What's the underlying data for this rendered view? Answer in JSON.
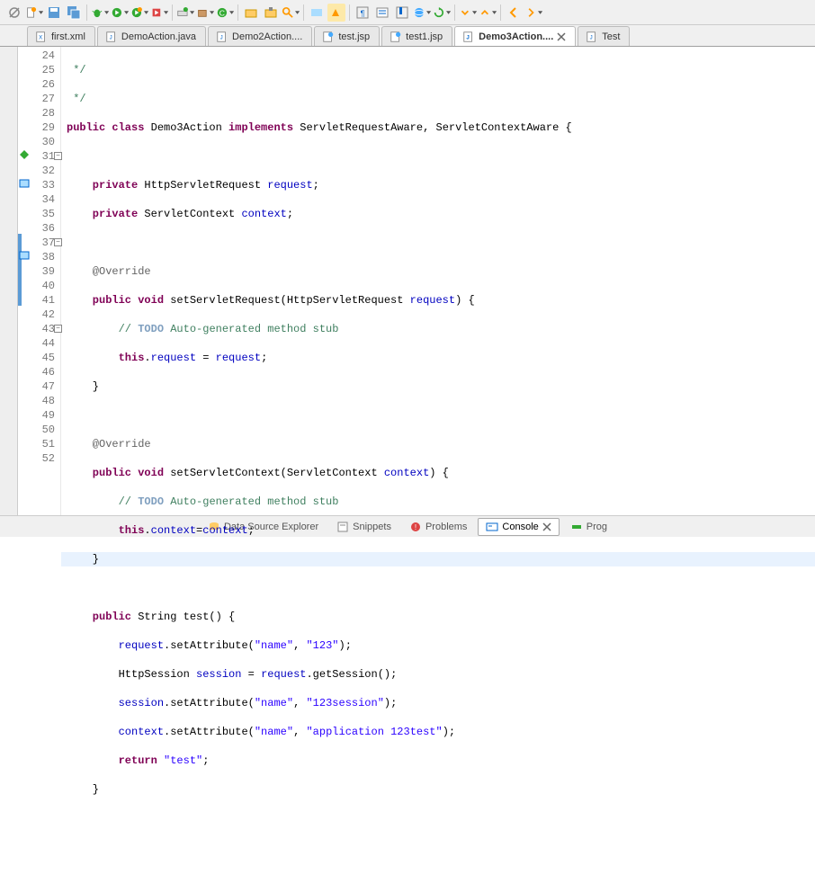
{
  "tabs": [
    {
      "label": "first.xml",
      "type": "xml"
    },
    {
      "label": "DemoAction.java",
      "type": "java"
    },
    {
      "label": "Demo2Action....",
      "type": "java"
    },
    {
      "label": "test.jsp",
      "type": "jsp"
    },
    {
      "label": "test1.jsp",
      "type": "jsp"
    },
    {
      "label": "Demo3Action....",
      "type": "java",
      "active": true,
      "closeable": true
    },
    {
      "label": "Test",
      "type": "java"
    }
  ],
  "lines": {
    "start": 24,
    "end": 52
  },
  "code": {
    "l24": " */",
    "l25": " */",
    "l26_pre": "public class ",
    "l26_name": "Demo3Action ",
    "l26_impl": "implements ",
    "l26_rest": "ServletRequestAware, ServletContextAware {",
    "l28_pre": "    private ",
    "l28_type": "HttpServletRequest ",
    "l28_var": "request",
    "l28_end": ";",
    "l29_pre": "    private ",
    "l29_type": "ServletContext ",
    "l29_var": "context",
    "l29_end": ";",
    "l31_ann": "    @Override",
    "l32_pre": "    public void ",
    "l32_name": "setServletRequest(HttpServletRequest ",
    "l32_arg": "request",
    "l32_end": ") {",
    "l33_cm": "        // ",
    "l33_todo": "TODO",
    "l33_rest": " Auto-generated method stub",
    "l34_pre": "        this",
    "l34_dot": ".",
    "l34_fd": "request",
    "l34_eq": " = ",
    "l34_var": "request",
    "l34_end": ";",
    "l35": "    }",
    "l37_ann": "    @Override",
    "l38_pre": "    public void ",
    "l38_name": "setServletContext(ServletContext ",
    "l38_arg": "context",
    "l38_end": ") {",
    "l39_cm": "        // ",
    "l39_todo": "TODO",
    "l39_rest": " Auto-generated method stub",
    "l40_pre": "        this",
    "l40_dot": ".",
    "l40_fd": "context",
    "l40_eq": "=",
    "l40_var": "context",
    "l40_end": ";",
    "l41": "    }",
    "l43_pre": "    public ",
    "l43_type": "String test() {",
    "l44_pre": "        ",
    "l44_fd": "request",
    "l44_call": ".setAttribute(",
    "l44_s1": "\"name\"",
    "l44_c": ", ",
    "l44_s2": "\"123\"",
    "l44_end": ");",
    "l45_pre": "        HttpSession ",
    "l45_var": "session",
    "l45_eq": " = ",
    "l45_fd": "request",
    "l45_call": ".getSession();",
    "l46_pre": "        ",
    "l46_var": "session",
    "l46_call": ".setAttribute(",
    "l46_s1": "\"name\"",
    "l46_c": ", ",
    "l46_s2": "\"123session\"",
    "l46_end": ");",
    "l47_pre": "        ",
    "l47_fd": "context",
    "l47_call": ".setAttribute(",
    "l47_s1": "\"name\"",
    "l47_c": ", ",
    "l47_s2": "\"application 123test\"",
    "l47_end": ");",
    "l48_pre": "        return ",
    "l48_s": "\"test\"",
    "l48_end": ";",
    "l49": "    }"
  },
  "bottomTabs": [
    {
      "label": "Data Source Explorer"
    },
    {
      "label": "Snippets"
    },
    {
      "label": "Problems"
    },
    {
      "label": "Console",
      "active": true,
      "closeable": true
    },
    {
      "label": "Prog"
    }
  ]
}
